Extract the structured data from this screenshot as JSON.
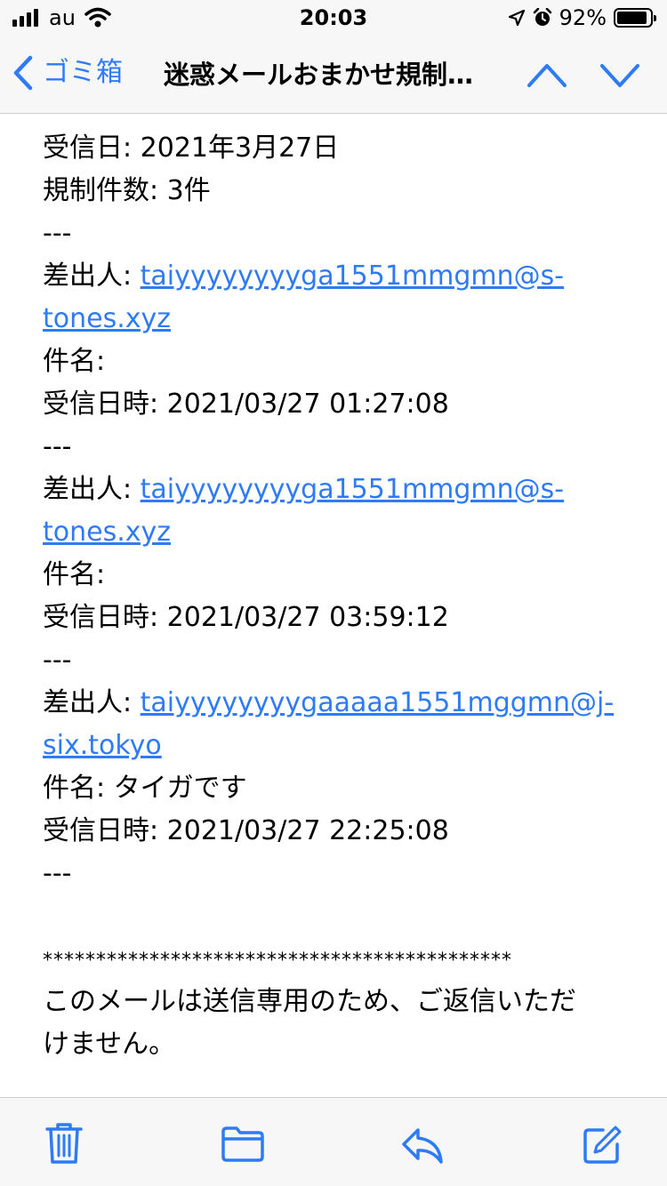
{
  "status_bar": {
    "carrier": "au",
    "time": "20:03",
    "battery_text": "92%",
    "battery_level": 0.92
  },
  "nav": {
    "back_label": "ゴミ箱",
    "title": "迷惑メールおまかせ規制…",
    "icons": {
      "back": "chevron-left-icon",
      "up": "chevron-up-icon",
      "down": "chevron-down-icon"
    }
  },
  "mail": {
    "received_date": " 受信日: 2021年3月27日",
    "count": "規制件数: 3件",
    "separator": "---",
    "entries": [
      {
        "sender_label": " 差出人: ",
        "sender_line1": "taiyyyyyyyyga1551mmgmn@s-",
        "sender_line2": "tones.xyz",
        "subject": "   件名: ",
        "received": "受信日時: 2021/03/27 01:27:08"
      },
      {
        "sender_label": " 差出人: ",
        "sender_line1": "taiyyyyyyyyga1551mmgmn@s-",
        "sender_line2": "tones.xyz",
        "subject": "   件名: ",
        "received": "受信日時: 2021/03/27 03:59:12"
      },
      {
        "sender_label": " 差出人: ",
        "sender_line1": "taiyyyyyyyygaaaaa1551mggmn@j-",
        "sender_line2": "six.tokyo",
        "subject": "   件名: タイガです",
        "received": "受信日時: 2021/03/27 22:25:08"
      }
    ],
    "stars": "********************************************",
    "footer_line1": "このメールは送信専用のため、ご返信いただ",
    "footer_line2": "けません。"
  },
  "toolbar": {
    "icons": [
      "trash-icon",
      "folder-icon",
      "reply-icon",
      "compose-icon"
    ]
  },
  "colors": {
    "accent": "#2f7bf6",
    "bar_bg": "#f7f7f7"
  }
}
